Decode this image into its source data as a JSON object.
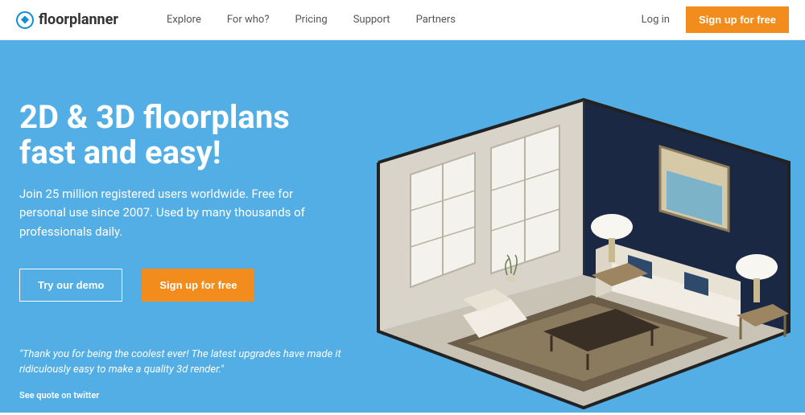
{
  "logo": {
    "text": "floorplanner"
  },
  "nav": {
    "links": [
      "Explore",
      "For who?",
      "Pricing",
      "Support",
      "Partners"
    ],
    "login": "Log in",
    "signup": "Sign up for free"
  },
  "hero": {
    "title_line1": "2D & 3D floorplans",
    "title_line2": "fast and easy!",
    "subtitle": "Join 25 million registered users worldwide. Free for personal use since 2007. Used by many thousands of professionals daily.",
    "demo_btn": "Try our demo",
    "signup_btn": "Sign up for free",
    "quote": "\"Thank you for being the coolest ever! The latest upgrades have made it ridiculously easy to make a quality 3d render.\"",
    "quote_link": "See quote on twitter"
  }
}
